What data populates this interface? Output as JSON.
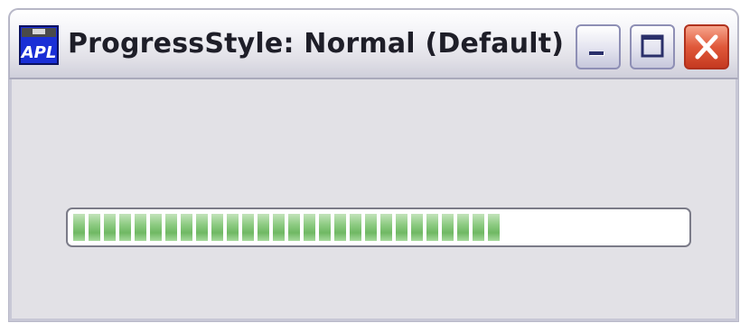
{
  "window": {
    "title": "ProgressStyle: Normal (Default)",
    "app_icon": "app-window-icon",
    "controls": {
      "minimize_icon": "minimize-icon",
      "maximize_icon": "maximize-icon",
      "close_icon": "close-icon"
    }
  },
  "progress_bar": {
    "style": "Normal",
    "value_fraction": 0.71,
    "fill_color": "#7dc272",
    "track_color": "#ffffff"
  }
}
